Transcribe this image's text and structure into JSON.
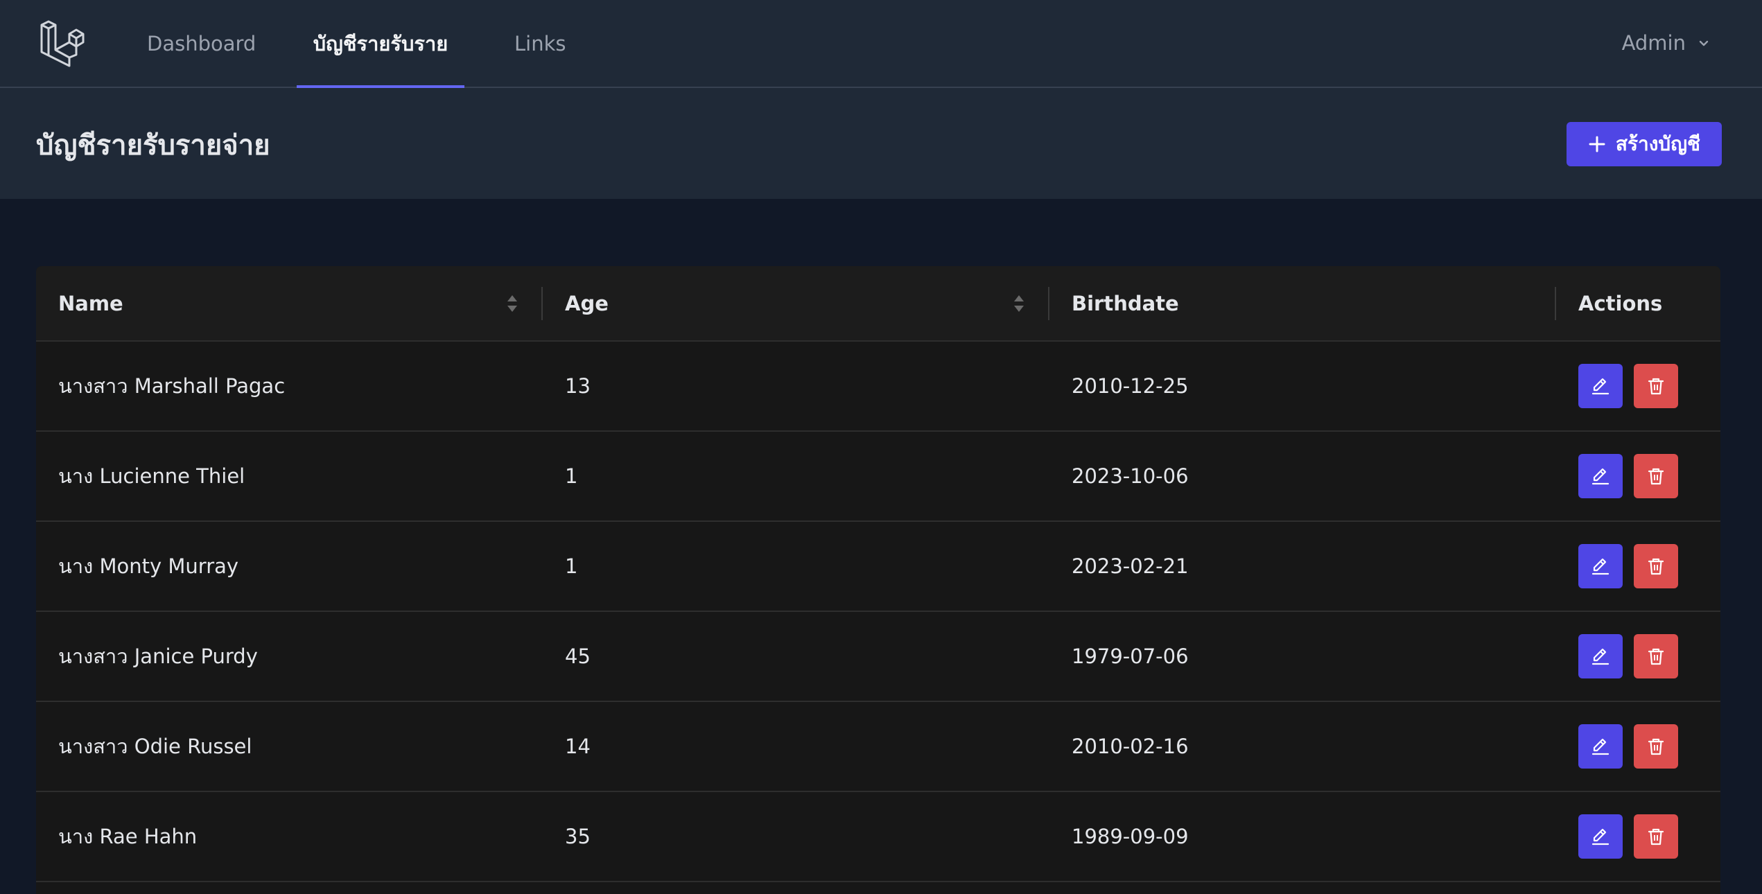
{
  "nav": {
    "links": [
      "Dashboard",
      "บัญชีรายรับรายจ่าย",
      "Links"
    ],
    "active_index": 1,
    "user_label": "Admin"
  },
  "header": {
    "title": "บัญชีรายรับรายจ่าย",
    "create_button_label": "สร้างบัญชี"
  },
  "table": {
    "columns": [
      "Name",
      "Age",
      "Birthdate",
      "Actions"
    ],
    "rows": [
      {
        "name": "นางสาว Marshall Pagac",
        "age": "13",
        "birthdate": "2010-12-25"
      },
      {
        "name": "นาง Lucienne Thiel",
        "age": "1",
        "birthdate": "2023-10-06"
      },
      {
        "name": "นาง Monty Murray",
        "age": "1",
        "birthdate": "2023-02-21"
      },
      {
        "name": "นางสาว Janice Purdy",
        "age": "45",
        "birthdate": "1979-07-06"
      },
      {
        "name": "นางสาว Odie Russel",
        "age": "14",
        "birthdate": "2010-02-16"
      },
      {
        "name": "นาง Rae Hahn",
        "age": "35",
        "birthdate": "1989-09-09"
      }
    ]
  },
  "colors": {
    "accent": "#4f46e5",
    "danger": "#dc4d4d",
    "nav_bg": "#1f2937",
    "page_bg": "#111827",
    "table_bg": "#171717"
  }
}
